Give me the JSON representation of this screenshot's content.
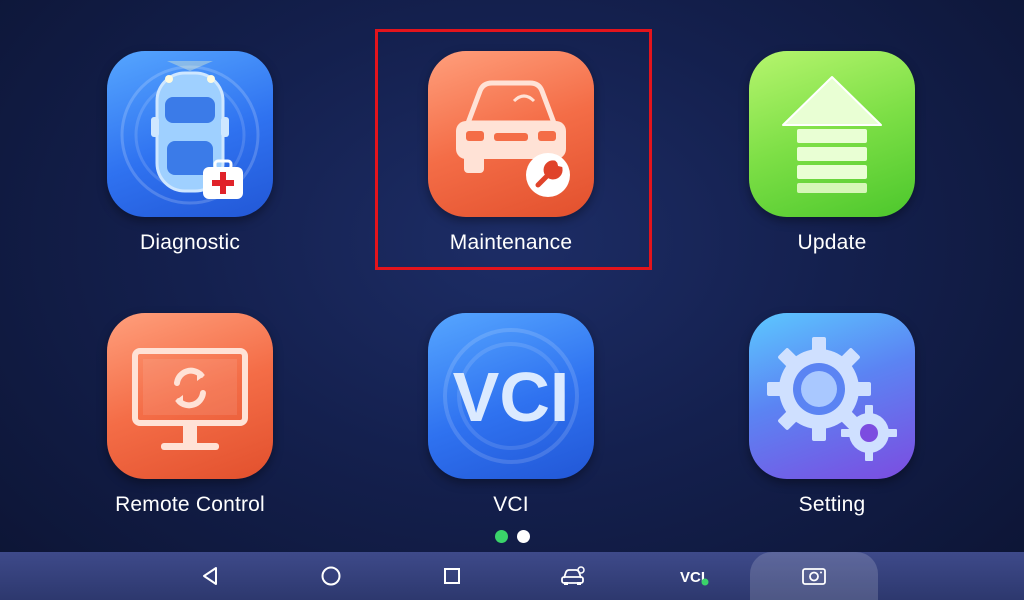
{
  "apps": [
    {
      "id": "diagnostic",
      "label": "Diagnostic",
      "icon": "car-diagnostic-icon",
      "color": "#2f72f0"
    },
    {
      "id": "maintenance",
      "label": "Maintenance",
      "icon": "car-wrench-icon",
      "color": "#f46d47"
    },
    {
      "id": "update",
      "label": "Update",
      "icon": "upload-arrow-icon",
      "color": "#7ddf46"
    },
    {
      "id": "remote-control",
      "label": "Remote Control",
      "icon": "monitor-sync-icon",
      "color": "#f46d47"
    },
    {
      "id": "vci",
      "label": "VCI",
      "icon": "vci-text-icon",
      "icon_text": "VCI",
      "color": "#2f72f0"
    },
    {
      "id": "setting",
      "label": "Setting",
      "icon": "gear-icon",
      "color": "#5b84f3"
    }
  ],
  "pager": {
    "total": 2,
    "current": 1,
    "active_color": "#3ad36a",
    "inactive_color": "#ffffff"
  },
  "highlight_color": "#e3141c",
  "navbar": {
    "items": [
      "back-icon",
      "home-icon",
      "recents-icon",
      "car-connect-icon",
      "vci-status-icon",
      "screenshot-icon"
    ],
    "vci_label": "VCI",
    "vci_status_color": "#3ad36a"
  }
}
